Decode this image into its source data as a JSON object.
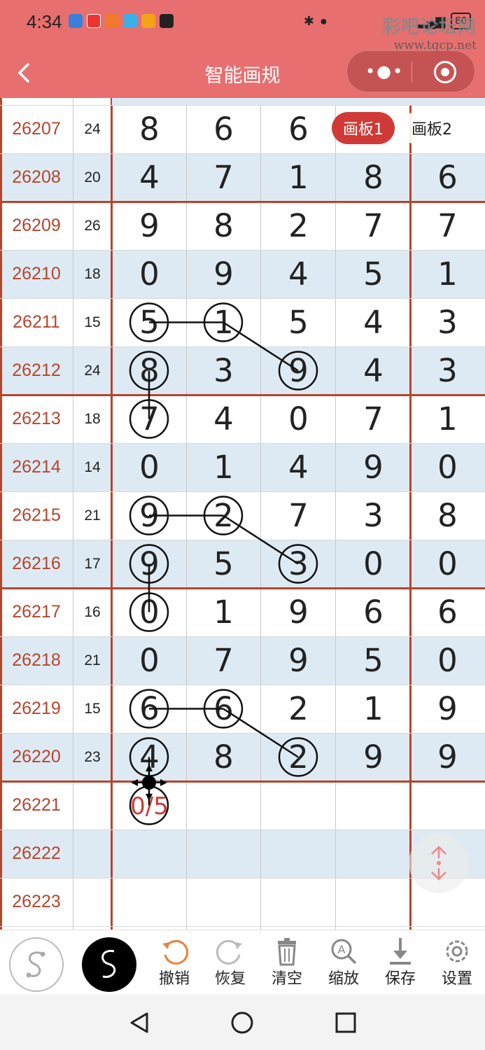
{
  "status_bar": {
    "time": "4:34",
    "battery": "86",
    "watermark_main": "彩吧论坛网",
    "watermark_url": "www.tqcp.net"
  },
  "nav": {
    "title": "智能画规",
    "back_icon": "chevron-left-icon",
    "menu_icon": "more-dots-icon",
    "close_icon": "target-circle-icon"
  },
  "board_tabs": [
    {
      "label": "画板1",
      "active": true
    },
    {
      "label": "画板2",
      "active": false
    }
  ],
  "rows": [
    {
      "period": "26207",
      "sum": "24",
      "digits": [
        "8",
        "6",
        "6",
        "",
        ""
      ]
    },
    {
      "period": "26208",
      "sum": "20",
      "digits": [
        "4",
        "7",
        "1",
        "8",
        "6"
      ]
    },
    {
      "period": "26209",
      "sum": "26",
      "digits": [
        "9",
        "8",
        "2",
        "7",
        "7"
      ]
    },
    {
      "period": "26210",
      "sum": "18",
      "digits": [
        "0",
        "9",
        "4",
        "5",
        "1"
      ]
    },
    {
      "period": "26211",
      "sum": "15",
      "digits": [
        "5",
        "1",
        "5",
        "4",
        "3"
      ]
    },
    {
      "period": "26212",
      "sum": "24",
      "digits": [
        "8",
        "3",
        "9",
        "4",
        "3"
      ]
    },
    {
      "period": "26213",
      "sum": "18",
      "digits": [
        "7",
        "4",
        "0",
        "7",
        "1"
      ]
    },
    {
      "period": "26214",
      "sum": "14",
      "digits": [
        "0",
        "1",
        "4",
        "9",
        "0"
      ]
    },
    {
      "period": "26215",
      "sum": "21",
      "digits": [
        "9",
        "2",
        "7",
        "3",
        "8"
      ]
    },
    {
      "period": "26216",
      "sum": "17",
      "digits": [
        "9",
        "5",
        "3",
        "0",
        "0"
      ]
    },
    {
      "period": "26217",
      "sum": "16",
      "digits": [
        "0",
        "1",
        "9",
        "6",
        "6"
      ]
    },
    {
      "period": "26218",
      "sum": "21",
      "digits": [
        "0",
        "7",
        "9",
        "5",
        "0"
      ]
    },
    {
      "period": "26219",
      "sum": "15",
      "digits": [
        "6",
        "6",
        "2",
        "1",
        "9"
      ]
    },
    {
      "period": "26220",
      "sum": "23",
      "digits": [
        "4",
        "8",
        "2",
        "9",
        "9"
      ]
    },
    {
      "period": "26221",
      "sum": "",
      "digits": [
        "0/5",
        "",
        "",
        "",
        ""
      ]
    },
    {
      "period": "26222",
      "sum": "",
      "digits": [
        "",
        "",
        "",
        "",
        ""
      ]
    },
    {
      "period": "26223",
      "sum": "",
      "digits": [
        "",
        "",
        "",
        "",
        ""
      ]
    }
  ],
  "prediction_text": "0/5",
  "toolbar": {
    "pen_light_icon": "curve-pen-light-icon",
    "pen_dark_icon": "curve-pen-dark-icon",
    "items": [
      {
        "label": "撤销",
        "icon": "undo-icon",
        "color": "#e8833a"
      },
      {
        "label": "恢复",
        "icon": "redo-icon",
        "color": "#bbbbbb"
      },
      {
        "label": "清空",
        "icon": "trash-icon",
        "color": "#888888"
      },
      {
        "label": "缩放",
        "icon": "zoom-icon",
        "color": "#888888"
      },
      {
        "label": "保存",
        "icon": "download-icon",
        "color": "#888888"
      },
      {
        "label": "设置",
        "icon": "gear-icon",
        "color": "#888888"
      }
    ]
  },
  "colors": {
    "header": "#e86f6f",
    "period_text": "#b5452b",
    "row_alt": "#deeaf3",
    "divider_red": "#b5452b",
    "active_tab": "#d03a36"
  }
}
